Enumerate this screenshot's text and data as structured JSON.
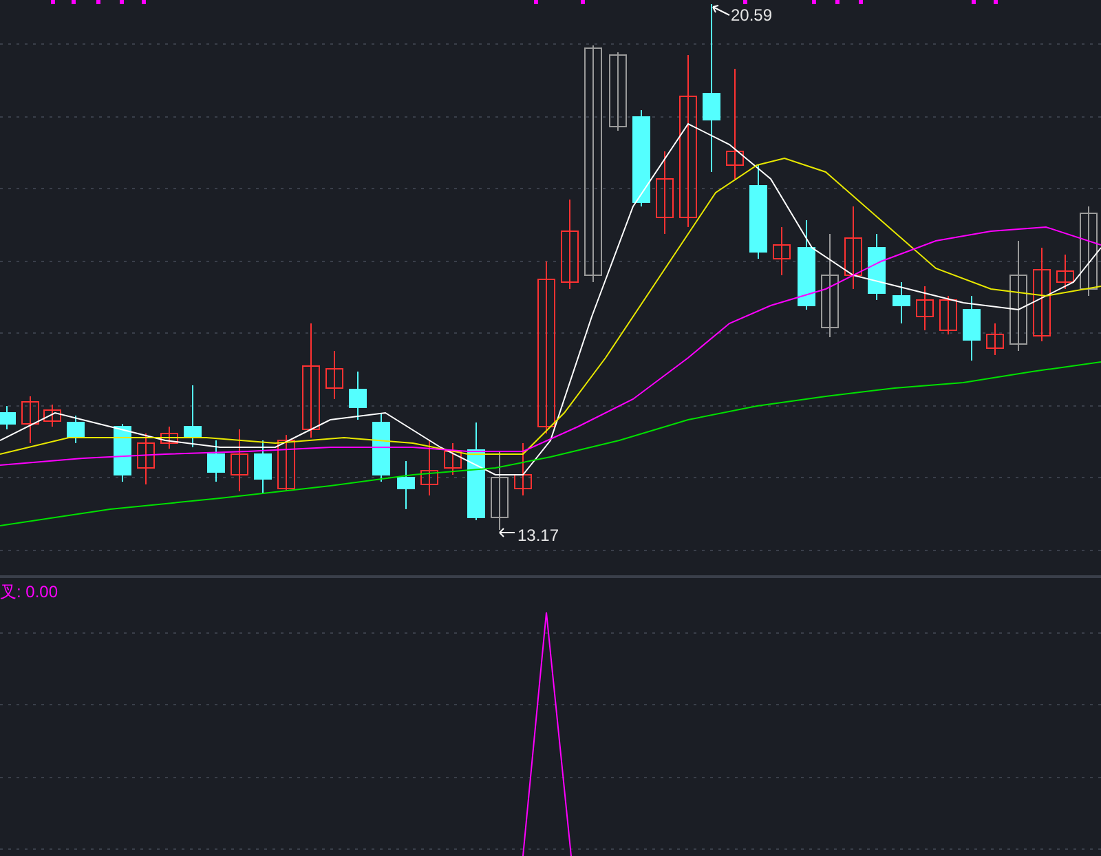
{
  "price_panel": {
    "high_label": "20.59",
    "low_label": "13.17"
  },
  "indicator_panel": {
    "label": "叉: 0.00"
  }
}
